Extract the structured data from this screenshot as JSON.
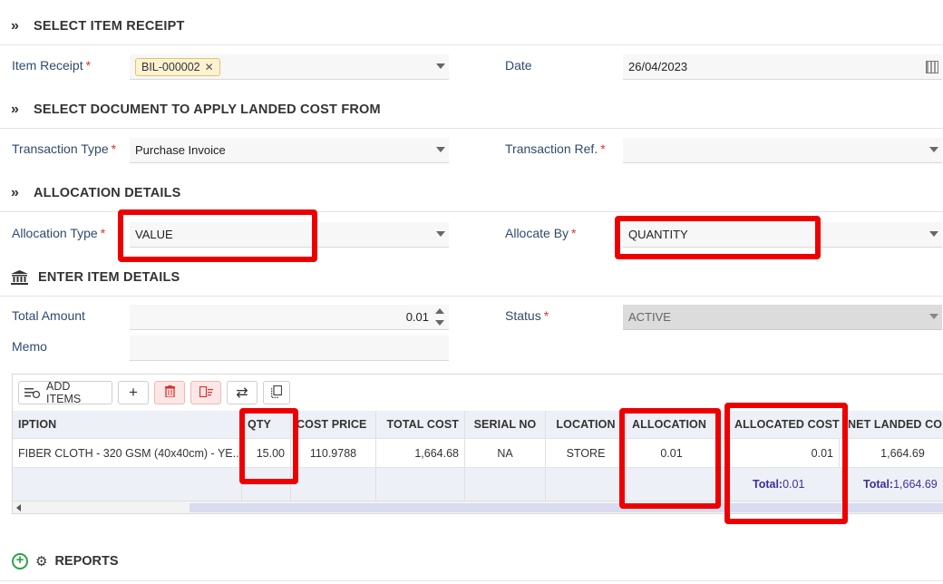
{
  "sections": {
    "select_item_receipt": "SELECT ITEM RECEIPT",
    "select_document": "SELECT DOCUMENT TO APPLY LANDED COST FROM",
    "allocation_details": "ALLOCATION DETAILS",
    "enter_item_details": "ENTER ITEM DETAILS",
    "reports": "REPORTS"
  },
  "receipt": {
    "item_receipt_label": "Item Receipt",
    "item_receipt_chip": "BIL-000002",
    "date_label": "Date",
    "date_value": "26/04/2023"
  },
  "document": {
    "transaction_type_label": "Transaction Type",
    "transaction_type_value": "Purchase Invoice",
    "transaction_ref_label": "Transaction Ref.",
    "transaction_ref_value": ""
  },
  "allocation": {
    "allocation_type_label": "Allocation Type",
    "allocation_type_value": "VALUE",
    "allocate_by_label": "Allocate By",
    "allocate_by_value": "QUANTITY"
  },
  "item_details": {
    "total_amount_label": "Total Amount",
    "total_amount_value": "0.01",
    "status_label": "Status",
    "status_value": "ACTIVE",
    "memo_label": "Memo",
    "memo_value": ""
  },
  "toolbar": {
    "add_items_label": "ADD ITEMS",
    "add_symbol": "+",
    "swap_symbol": "⇄"
  },
  "grid": {
    "headers": {
      "description": "IPTION",
      "qty": "QTY",
      "cost_price": "COST PRICE",
      "total_cost": "TOTAL COST",
      "serial_no": "SERIAL NO",
      "location": "LOCATION",
      "allocation": "ALLOCATION",
      "allocated_cost": "ALLOCATED COST",
      "net_landed_cost": "NET LANDED CO"
    },
    "row": {
      "description": "FIBER CLOTH - 320 GSM (40x40cm) - YE...",
      "qty": "15.00",
      "cost_price": "110.9788",
      "total_cost": "1,664.68",
      "serial_no": "NA",
      "location": "STORE",
      "allocation": "0.01",
      "allocated_cost": "0.01",
      "net_landed_cost": "1,664.69"
    },
    "footer": {
      "total_label": "Total:",
      "allocated_cost_total": "0.01",
      "net_landed_total": "1,664.69"
    }
  },
  "colors": {
    "highlight": "#ee0000",
    "required": "#d9342b",
    "label": "#2f4a6d",
    "total_text": "#3d2f9a"
  }
}
